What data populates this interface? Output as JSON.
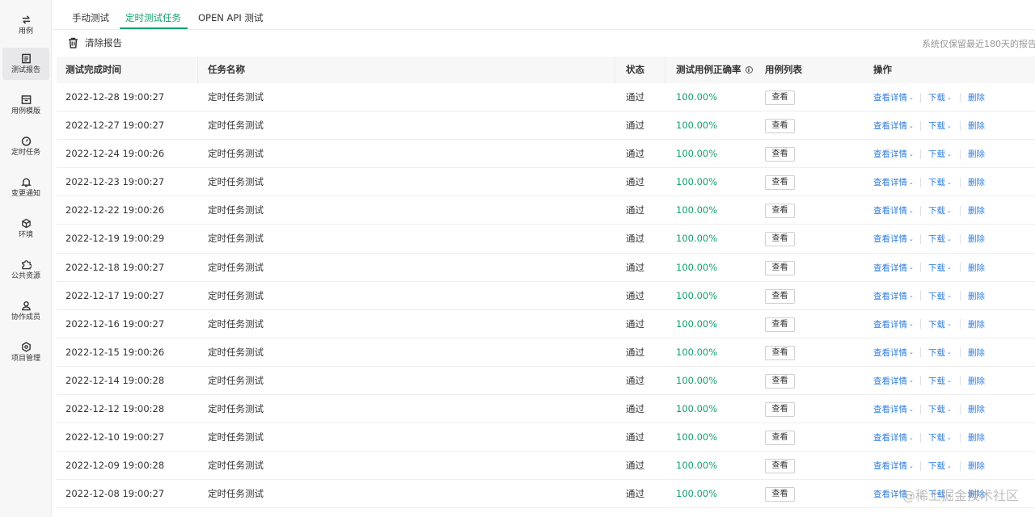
{
  "sidebar": {
    "items": [
      {
        "label": "用例",
        "icon": "swap-arrows-icon"
      },
      {
        "label": "测试报告",
        "icon": "report-icon"
      },
      {
        "label": "用例模版",
        "icon": "template-icon"
      },
      {
        "label": "定时任务",
        "icon": "timer-icon"
      },
      {
        "label": "变更通知",
        "icon": "bell-icon"
      },
      {
        "label": "环境",
        "icon": "cube-icon"
      },
      {
        "label": "公共资源",
        "icon": "puzzle-icon"
      },
      {
        "label": "协作成员",
        "icon": "user-icon"
      },
      {
        "label": "项目管理",
        "icon": "gear-icon"
      }
    ]
  },
  "tabs": [
    {
      "label": "手动测试"
    },
    {
      "label": "定时测试任务"
    },
    {
      "label": "OPEN API 测试"
    }
  ],
  "toolbar": {
    "clear_label": "清除报告",
    "retention_note": "系统仅保留最近180天的报告"
  },
  "table": {
    "headers": {
      "time": "测试完成时间",
      "name": "任务名称",
      "status": "状态",
      "rate": "测试用例正确率",
      "cases": "用例列表",
      "ops": "操作"
    },
    "view_label": "查看",
    "detail_label": "查看详情",
    "download_label": "下载",
    "delete_label": "删除",
    "rows": [
      {
        "time": "2022-12-28 19:00:27",
        "name": "定时任务测试",
        "status": "通过",
        "rate": "100.00%"
      },
      {
        "time": "2022-12-27 19:00:27",
        "name": "定时任务测试",
        "status": "通过",
        "rate": "100.00%"
      },
      {
        "time": "2022-12-24 19:00:26",
        "name": "定时任务测试",
        "status": "通过",
        "rate": "100.00%"
      },
      {
        "time": "2022-12-23 19:00:27",
        "name": "定时任务测试",
        "status": "通过",
        "rate": "100.00%"
      },
      {
        "time": "2022-12-22 19:00:26",
        "name": "定时任务测试",
        "status": "通过",
        "rate": "100.00%"
      },
      {
        "time": "2022-12-19 19:00:29",
        "name": "定时任务测试",
        "status": "通过",
        "rate": "100.00%"
      },
      {
        "time": "2022-12-18 19:00:27",
        "name": "定时任务测试",
        "status": "通过",
        "rate": "100.00%"
      },
      {
        "time": "2022-12-17 19:00:27",
        "name": "定时任务测试",
        "status": "通过",
        "rate": "100.00%"
      },
      {
        "time": "2022-12-16 19:00:27",
        "name": "定时任务测试",
        "status": "通过",
        "rate": "100.00%"
      },
      {
        "time": "2022-12-15 19:00:26",
        "name": "定时任务测试",
        "status": "通过",
        "rate": "100.00%"
      },
      {
        "time": "2022-12-14 19:00:28",
        "name": "定时任务测试",
        "status": "通过",
        "rate": "100.00%"
      },
      {
        "time": "2022-12-12 19:00:28",
        "name": "定时任务测试",
        "status": "通过",
        "rate": "100.00%"
      },
      {
        "time": "2022-12-10 19:00:27",
        "name": "定时任务测试",
        "status": "通过",
        "rate": "100.00%"
      },
      {
        "time": "2022-12-09 19:00:28",
        "name": "定时任务测试",
        "status": "通过",
        "rate": "100.00%"
      },
      {
        "time": "2022-12-08 19:00:27",
        "name": "定时任务测试",
        "status": "通过",
        "rate": "100.00%"
      }
    ]
  },
  "watermark": "@稀土掘金技术社区",
  "colors": {
    "accent": "#12a26b",
    "link": "#2f7de1"
  }
}
